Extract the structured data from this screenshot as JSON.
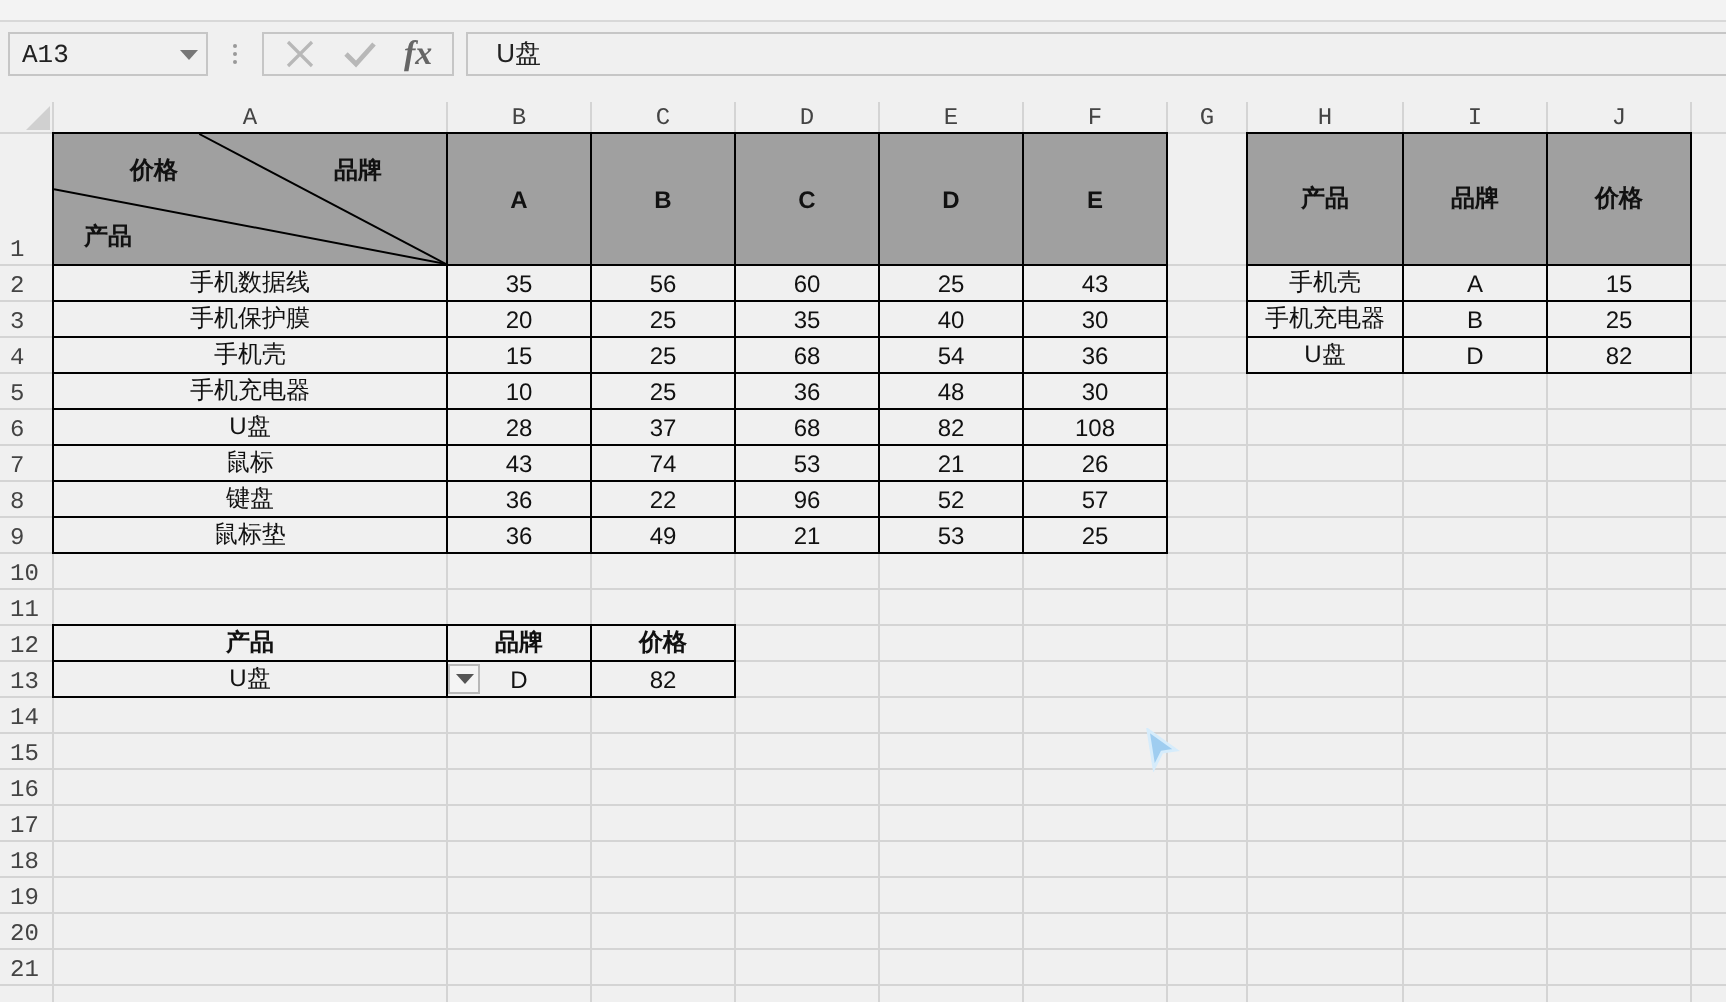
{
  "formula_bar": {
    "name_box": "A13",
    "function_label": "fx",
    "formula": "U盘"
  },
  "column_headers": [
    "A",
    "B",
    "C",
    "D",
    "E",
    "F",
    "G",
    "H",
    "I",
    "J"
  ],
  "row_headers": [
    "1",
    "2",
    "3",
    "4",
    "5",
    "6",
    "7",
    "8",
    "9",
    "10",
    "11",
    "12",
    "13",
    "14",
    "15",
    "16",
    "17",
    "18",
    "19",
    "20",
    "21"
  ],
  "main_table": {
    "corner": {
      "top_left": "价格",
      "top_right": "品牌",
      "bottom_left": "产品"
    },
    "columns": [
      "A",
      "B",
      "C",
      "D",
      "E"
    ],
    "rows": [
      {
        "product": "手机数据线",
        "values": [
          "35",
          "56",
          "60",
          "25",
          "43"
        ]
      },
      {
        "product": "手机保护膜",
        "values": [
          "20",
          "25",
          "35",
          "40",
          "30"
        ]
      },
      {
        "product": "手机壳",
        "values": [
          "15",
          "25",
          "68",
          "54",
          "36"
        ]
      },
      {
        "product": "手机充电器",
        "values": [
          "10",
          "25",
          "36",
          "48",
          "30"
        ]
      },
      {
        "product": "U盘",
        "values": [
          "28",
          "37",
          "68",
          "82",
          "108"
        ]
      },
      {
        "product": "鼠标",
        "values": [
          "43",
          "74",
          "53",
          "21",
          "26"
        ]
      },
      {
        "product": "键盘",
        "values": [
          "36",
          "22",
          "96",
          "52",
          "57"
        ]
      },
      {
        "product": "鼠标垫",
        "values": [
          "36",
          "49",
          "21",
          "53",
          "25"
        ]
      }
    ]
  },
  "lookup_table": {
    "columns": [
      "产品",
      "品牌",
      "价格"
    ],
    "rows": [
      [
        "手机壳",
        "A",
        "15"
      ],
      [
        "手机充电器",
        "B",
        "25"
      ],
      [
        "U盘",
        "D",
        "82"
      ]
    ]
  },
  "query_table": {
    "columns": [
      "产品",
      "品牌",
      "价格"
    ],
    "values": [
      "U盘",
      "D",
      "82"
    ]
  }
}
